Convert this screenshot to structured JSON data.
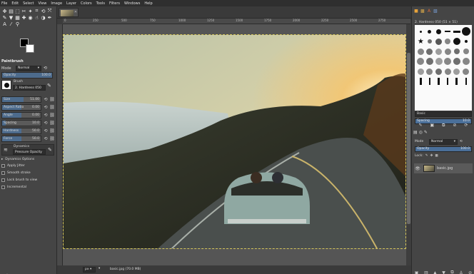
{
  "menu": [
    "File",
    "Edit",
    "Select",
    "View",
    "Image",
    "Layer",
    "Colors",
    "Tools",
    "Filters",
    "Windows",
    "Help"
  ],
  "tool_options": {
    "title": "Paintbrush",
    "mode_label": "Mode",
    "mode_value": "Normal",
    "opacity_label": "Opacity",
    "opacity_value": "100.0",
    "brush_label": "Brush",
    "brush_value": "2. Hardness 050",
    "sliders": [
      {
        "label": "Size",
        "value": "51.00",
        "fill": 0.55
      },
      {
        "label": "Aspect Ratio",
        "value": "0.00",
        "fill": 0.5
      },
      {
        "label": "Angle",
        "value": "0.00",
        "fill": 0.5
      },
      {
        "label": "Spacing",
        "value": "10.0",
        "fill": 0.1
      },
      {
        "label": "Hardness",
        "value": "50.0",
        "fill": 0.5
      },
      {
        "label": "Force",
        "value": "50.0",
        "fill": 0.5
      }
    ],
    "dynamics_label": "Dynamics",
    "dynamics_value": "Pressure Opacity",
    "dynamics_options": "Dynamics Options",
    "checks": [
      "Apply Jitter",
      "Smooth stroke",
      "Lock brush to view",
      "Incremental"
    ]
  },
  "ruler_marks": [
    "0",
    "250",
    "500",
    "750",
    "1000",
    "1250",
    "1500",
    "1750",
    "2000",
    "2250",
    "2500",
    "2750"
  ],
  "status": {
    "unit": "px",
    "zoom": "▾",
    "text": "basic.jpg (70.0 MB)"
  },
  "dock": {
    "brush_title": "2. Hardness 050 (51 × 51)",
    "tag_label": "Basic",
    "spacing_label": "Spacing",
    "spacing_value": "10.0",
    "mode_label": "Mode",
    "mode_value": "Normal",
    "opacity_label": "Opacity",
    "opacity_value": "100.0",
    "lock_label": "Lock:",
    "layer_name": "basic.jpg"
  }
}
